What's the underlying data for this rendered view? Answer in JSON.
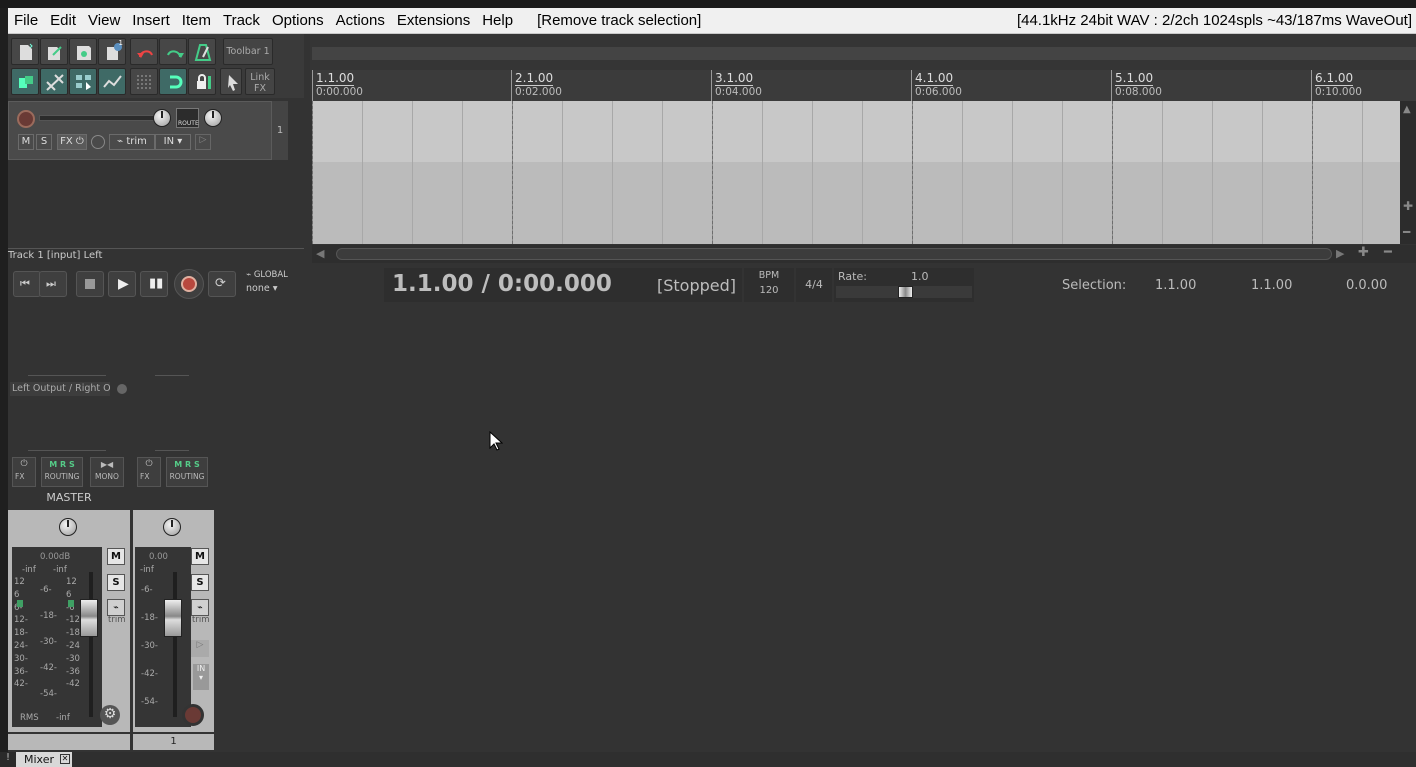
{
  "menubar": {
    "items": [
      "File",
      "Edit",
      "View",
      "Insert",
      "Item",
      "Track",
      "Options",
      "Actions",
      "Extensions",
      "Help"
    ],
    "last_action": "[Remove track selection]",
    "audio_status": "[44.1kHz 24bit WAV : 2/2ch 1024spls ~43/187ms WaveOut]"
  },
  "toolbar": {
    "name": "Toolbar 1",
    "link_fx_label_line1": "Link",
    "link_fx_label_line2": "FX",
    "badge_count": "1"
  },
  "ruler": {
    "marks": [
      {
        "bar": "1.1.00",
        "time": "0:00.000"
      },
      {
        "bar": "2.1.00",
        "time": "0:02.000"
      },
      {
        "bar": "3.1.00",
        "time": "0:04.000"
      },
      {
        "bar": "4.1.00",
        "time": "0:06.000"
      },
      {
        "bar": "5.1.00",
        "time": "0:08.000"
      },
      {
        "bar": "6.1.00",
        "time": "0:10.000"
      }
    ]
  },
  "track": {
    "number": "1",
    "mute_label": "M",
    "solo_label": "S",
    "fx_label": "FX",
    "route_label": "ROUTE",
    "trim_label": "trim",
    "in_label": "IN",
    "input_info": "Track 1 [input] Left"
  },
  "transport": {
    "global_label": "GLOBAL",
    "global_value": "none",
    "position": "1.1.00 / 0:00.000",
    "state": "[Stopped]",
    "bpm_label": "BPM",
    "bpm_value": "120",
    "time_signature": "4/4",
    "rate_label": "Rate:",
    "rate_value": "1.0",
    "selection_label": "Selection:",
    "selection_start": "1.1.00",
    "selection_end": "1.1.00",
    "selection_length": "0.0.00"
  },
  "mixer": {
    "output_label": "Left Output / Right Output",
    "fx_label": "FX",
    "routing_label": "ROUTING",
    "mono_label": "MONO",
    "master": {
      "name": "MASTER",
      "db": "0.00dB",
      "peak_l": "-inf",
      "peak_r": "-inf",
      "mode": "RMS",
      "rms_value": "-inf",
      "scale_inner": [
        "-6-",
        "-18-",
        "-30-",
        "-42-",
        "-54-"
      ],
      "scale_outer": [
        "12",
        "6",
        "6-",
        "12-",
        "18-",
        "24-",
        "30-",
        "36-",
        "42-"
      ],
      "scale_right": [
        "12",
        "6",
        "-6",
        "-12",
        "-18",
        "-24",
        "-30",
        "-36",
        "-42"
      ],
      "mute_label": "M",
      "solo_label": "S",
      "trim_label": "trim"
    },
    "track1": {
      "db": "0.00",
      "peak": "-inf",
      "scale": [
        "-6-",
        "-18-",
        "-30-",
        "-42-",
        "-54-"
      ],
      "mute_label": "M",
      "solo_label": "S",
      "trim_label": "trim",
      "in_label": "IN",
      "number": "1"
    },
    "tab_label": "Mixer",
    "bottom_mark": "!"
  },
  "colors": {
    "menubar_bg": "#f0f0f0",
    "window_bg": "#333333",
    "track_lane": "#c8c8c8",
    "accent_teal": "#3f6a66",
    "record_red": "#b8483e"
  }
}
